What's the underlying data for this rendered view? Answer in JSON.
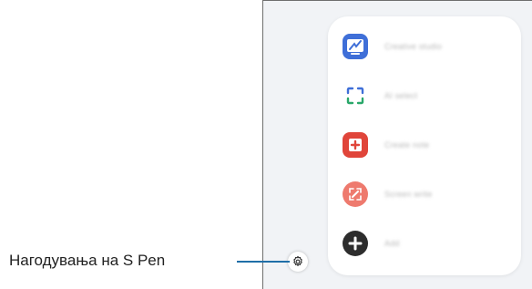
{
  "callout": {
    "label": "Нагодувања на S Pen"
  },
  "menu": {
    "items": [
      {
        "label": "Creative studio",
        "icon": "creative-studio-icon"
      },
      {
        "label": "AI select",
        "icon": "ai-select-icon"
      },
      {
        "label": "Create note",
        "icon": "create-note-icon"
      },
      {
        "label": "Screen write",
        "icon": "screen-write-icon"
      },
      {
        "label": "Add",
        "icon": "add-icon"
      }
    ]
  },
  "settings": {
    "icon": "gear-icon"
  },
  "colors": {
    "accent_line": "#1f6fa8",
    "creative": "#3f6fd8",
    "note": "#e0453a",
    "screen_write": "#ee7a6e",
    "add": "#2d2d2d"
  }
}
